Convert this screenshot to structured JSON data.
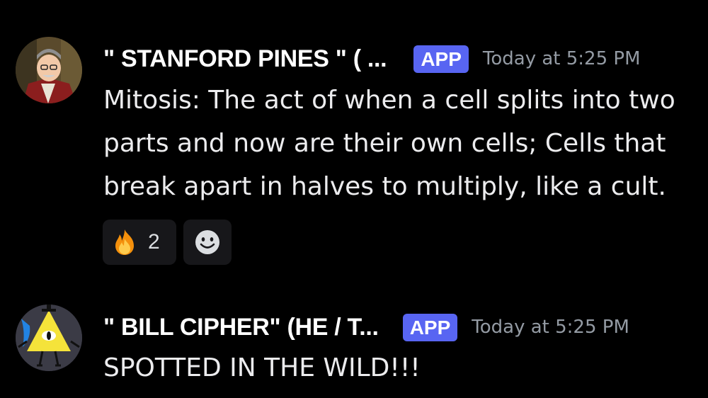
{
  "messages": [
    {
      "username": "\" STANFORD PINES \" ( ...",
      "badge": "APP",
      "timestamp": "Today at 5:25 PM",
      "lines": [
        "Mitosis: The act of when a cell splits into two",
        "parts and now are their own cells; Cells that",
        "break apart in halves to multiply, like a cult."
      ],
      "reactions": [
        {
          "emoji": "fire-emoji",
          "count": "2"
        }
      ],
      "add_reaction_icon": "smiley-add-reaction-icon"
    },
    {
      "username": "\" BILL CIPHER\" (HE / T...",
      "badge": "APP",
      "timestamp": "Today at 5:25 PM",
      "lines": [
        "SPOTTED IN THE WILD!!!"
      ]
    }
  ],
  "colors": {
    "background": "#000000",
    "badge": "#5865f2",
    "timestamp": "#949ba4",
    "reaction_bg": "#17171a"
  }
}
